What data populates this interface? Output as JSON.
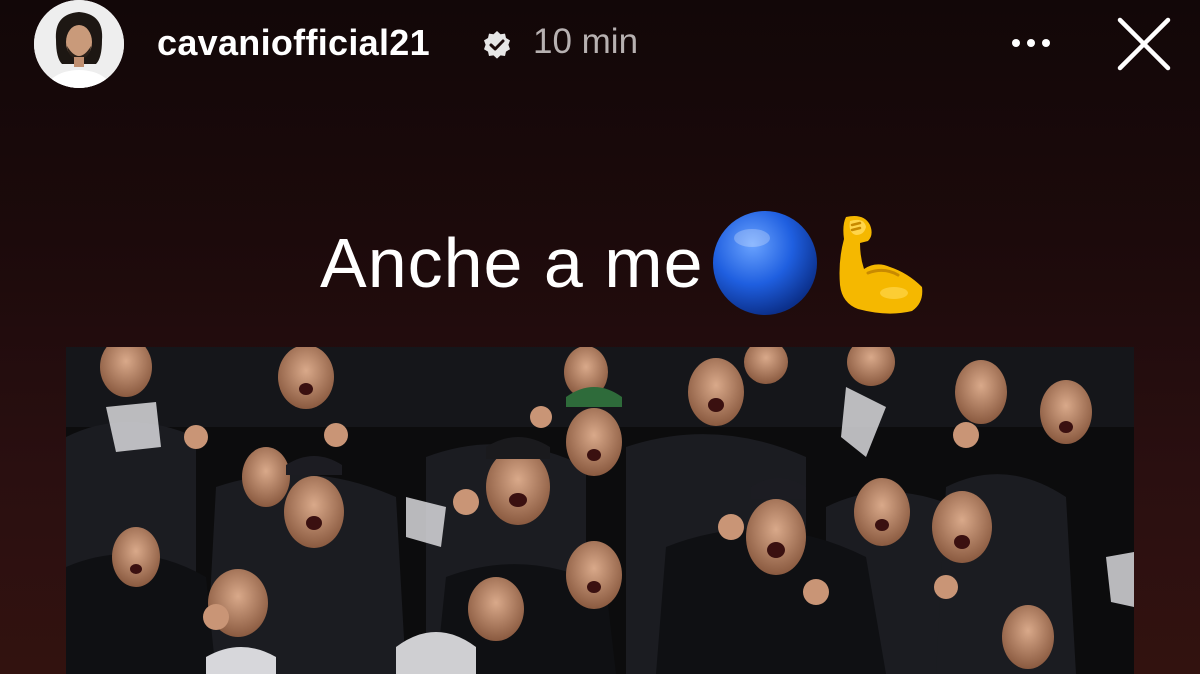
{
  "story": {
    "username": "cavaniofficial21",
    "time_ago": "10 min",
    "caption": "Anche a me",
    "caption_emojis": [
      "blue-circle-emoji",
      "flexed-biceps-emoji"
    ]
  },
  "icons": {
    "verified": "verified-badge-icon",
    "more": "more-options-icon",
    "close": "close-icon"
  },
  "colors": {
    "background_top": "#120708",
    "background_bottom": "#32120f",
    "text": "#ffffff",
    "timestamp": "#b7b1b1",
    "emoji_blue": "#1f5fe0",
    "emoji_yellow": "#f5b800"
  },
  "media": {
    "type": "photo",
    "subject": "crowd-of-cheering-fans"
  }
}
